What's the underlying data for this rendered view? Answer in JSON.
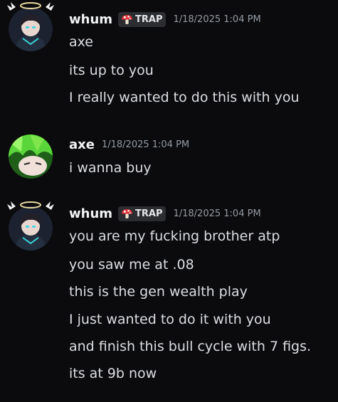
{
  "colors": {
    "background": "#0b0b0d",
    "username": "#f2f3f5",
    "message_text": "#dbdee1",
    "timestamp": "#949ba4",
    "tag_bg": "#2b2d31"
  },
  "messages": [
    {
      "author": "whum",
      "tag": "TRAP",
      "tag_icon": "mushroom-icon",
      "timestamp": "1/18/2025 1:04 PM",
      "lines": [
        "axe",
        "its up to you",
        "I really wanted to do this with you"
      ]
    },
    {
      "author": "axe",
      "timestamp": "1/18/2025 1:04 PM",
      "lines": [
        "i wanna buy"
      ]
    },
    {
      "author": "whum",
      "tag": "TRAP",
      "tag_icon": "mushroom-icon",
      "timestamp": "1/18/2025 1:04 PM",
      "lines": [
        "you are my fucking brother atp",
        "you saw me at .08",
        "this is the gen wealth play",
        "I just wanted to do it with you",
        "and finish this bull cycle with 7 figs.",
        "its at 9b now"
      ]
    }
  ]
}
